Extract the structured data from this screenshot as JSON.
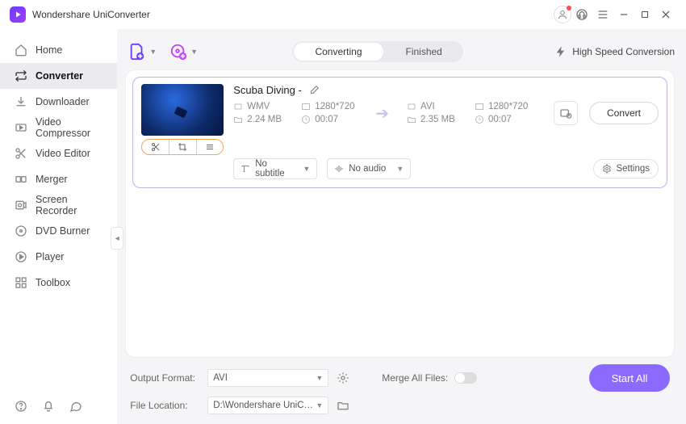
{
  "app": {
    "title": "Wondershare UniConverter"
  },
  "sidebar": {
    "items": [
      {
        "label": "Home"
      },
      {
        "label": "Converter"
      },
      {
        "label": "Downloader"
      },
      {
        "label": "Video Compressor"
      },
      {
        "label": "Video Editor"
      },
      {
        "label": "Merger"
      },
      {
        "label": "Screen Recorder"
      },
      {
        "label": "DVD Burner"
      },
      {
        "label": "Player"
      },
      {
        "label": "Toolbox"
      }
    ]
  },
  "tabs": {
    "converting": "Converting",
    "finished": "Finished"
  },
  "toolbar": {
    "high_speed": "High Speed Conversion"
  },
  "item": {
    "title": "Scuba Diving -",
    "src": {
      "format": "WMV",
      "resolution": "1280*720",
      "size": "2.24 MB",
      "duration": "00:07"
    },
    "dst": {
      "format": "AVI",
      "resolution": "1280*720",
      "size": "2.35 MB",
      "duration": "00:07"
    },
    "subtitle": "No subtitle",
    "audio": "No audio",
    "settings": "Settings",
    "convert": "Convert"
  },
  "footer": {
    "output_format_label": "Output Format:",
    "output_format_value": "AVI",
    "file_location_label": "File Location:",
    "file_location_value": "D:\\Wondershare UniConverter",
    "merge_label": "Merge All Files:",
    "start_all": "Start All"
  }
}
